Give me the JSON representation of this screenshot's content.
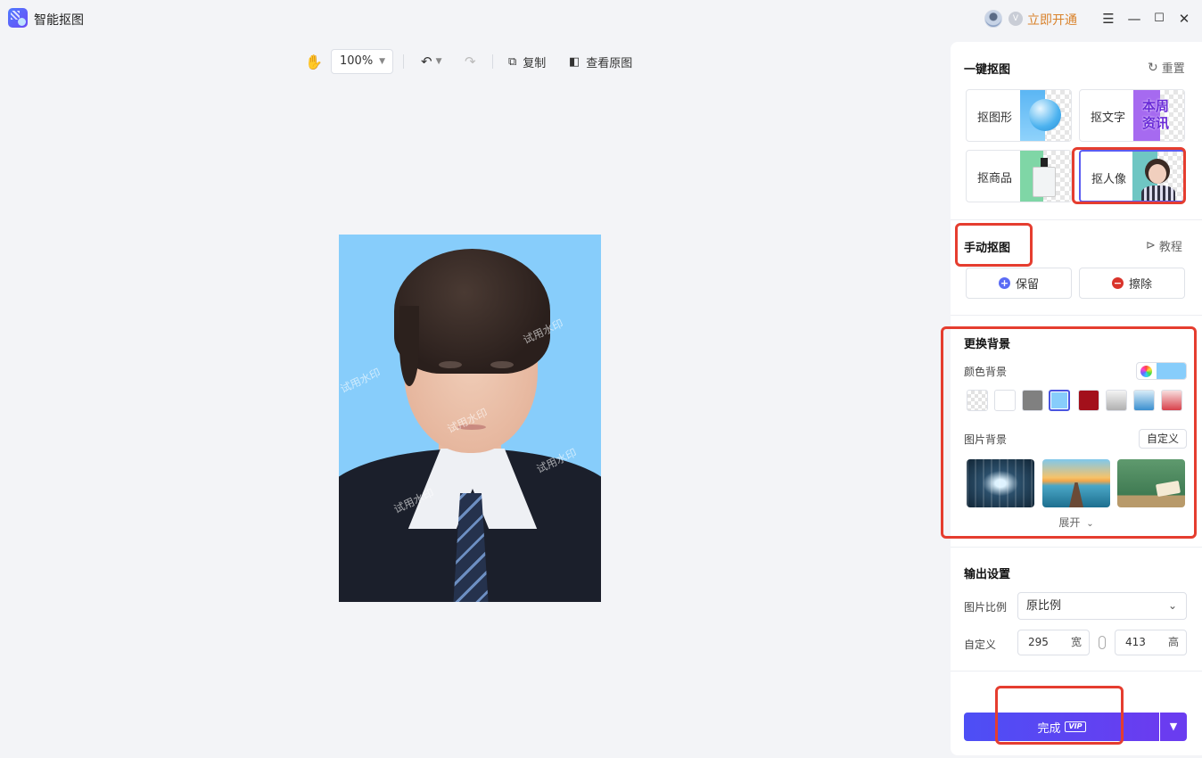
{
  "app": {
    "title": "智能抠图",
    "open_vip": "立即开通"
  },
  "toolbar": {
    "zoom": "100%",
    "copy": "复制",
    "view_original": "查看原图"
  },
  "watermark": "试用水印",
  "panel": {
    "one_click": {
      "title": "一键抠图",
      "reset": "重置",
      "cards": [
        {
          "label": "抠图形"
        },
        {
          "label": "抠文字",
          "thumb_text_1": "本周",
          "thumb_text_2": "资讯"
        },
        {
          "label": "抠商品"
        },
        {
          "label": "抠人像"
        }
      ]
    },
    "manual": {
      "title": "手动抠图",
      "tutorial": "教程",
      "keep": "保留",
      "erase": "擦除"
    },
    "background": {
      "title": "更换背景",
      "color_label": "颜色背景",
      "selected_color": "#87cdfb",
      "swatches": [
        "transparent",
        "#ffffff",
        "#808080",
        "#87cdfb",
        "#a3101b",
        "gray-gradient",
        "blue-gradient",
        "red-gradient"
      ],
      "image_label": "图片背景",
      "custom": "自定义",
      "expand": "展开"
    },
    "output": {
      "title": "输出设置",
      "ratio_label": "图片比例",
      "ratio_value": "原比例",
      "custom_label": "自定义",
      "width": "295",
      "width_unit": "宽",
      "height": "413",
      "height_unit": "高"
    },
    "done": {
      "label": "完成",
      "vip": "VIP"
    }
  },
  "colors": {
    "accent": "#5b4ff2",
    "highlight": "#e53d2f",
    "vip": "#d9822b"
  }
}
